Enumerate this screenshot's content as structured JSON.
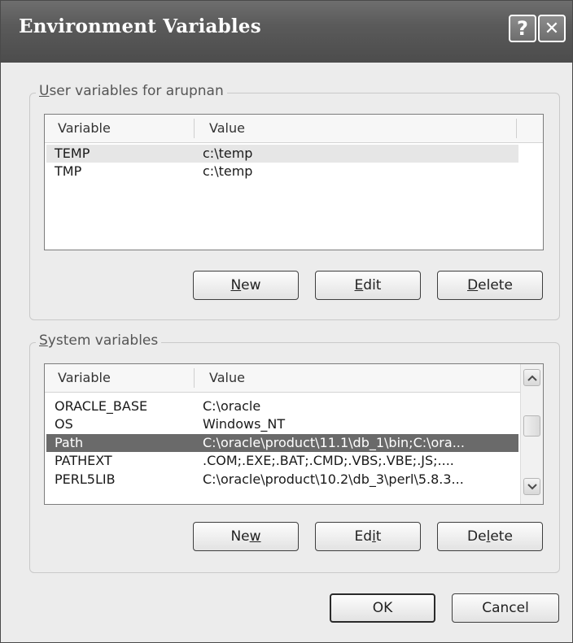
{
  "dialog": {
    "title": "Environment Variables",
    "help_button": "?",
    "close_button": "✕"
  },
  "user_group": {
    "legend_prefix": "U",
    "legend_rest": "ser variables for arupnan",
    "columns": [
      "Variable",
      "Value"
    ],
    "rows": [
      {
        "variable": "TEMP",
        "value": "c:\\temp"
      },
      {
        "variable": "TMP",
        "value": "c:\\temp"
      }
    ],
    "buttons": {
      "new": {
        "accel": "N",
        "rest": "ew"
      },
      "edit": {
        "accel": "E",
        "rest": "dit"
      },
      "delete": {
        "accel": "D",
        "rest": "elete"
      }
    }
  },
  "system_group": {
    "legend_prefix": "S",
    "legend_rest": "ystem variables",
    "columns": [
      "Variable",
      "Value"
    ],
    "rows": [
      {
        "variable": "ORACLE_BASE",
        "value": "C:\\oracle"
      },
      {
        "variable": "OS",
        "value": "Windows_NT"
      },
      {
        "variable": "Path",
        "value": "C:\\oracle\\product\\11.1\\db_1\\bin;C:\\ora..."
      },
      {
        "variable": "PATHEXT",
        "value": ".COM;.EXE;.BAT;.CMD;.VBS;.VBE;.JS;...."
      },
      {
        "variable": "PERL5LIB",
        "value": "C:\\oracle\\product\\10.2\\db_3\\perl\\5.8.3..."
      }
    ],
    "selected_row": "Path",
    "buttons": {
      "new": {
        "pre": "Ne",
        "accel": "w",
        "post": ""
      },
      "edit": {
        "pre": "Ed",
        "accel": "i",
        "post": "t"
      },
      "delete": {
        "pre": "De",
        "accel": "l",
        "post": "ete"
      }
    }
  },
  "footer": {
    "ok_label": "OK",
    "cancel_label": "Cancel"
  }
}
